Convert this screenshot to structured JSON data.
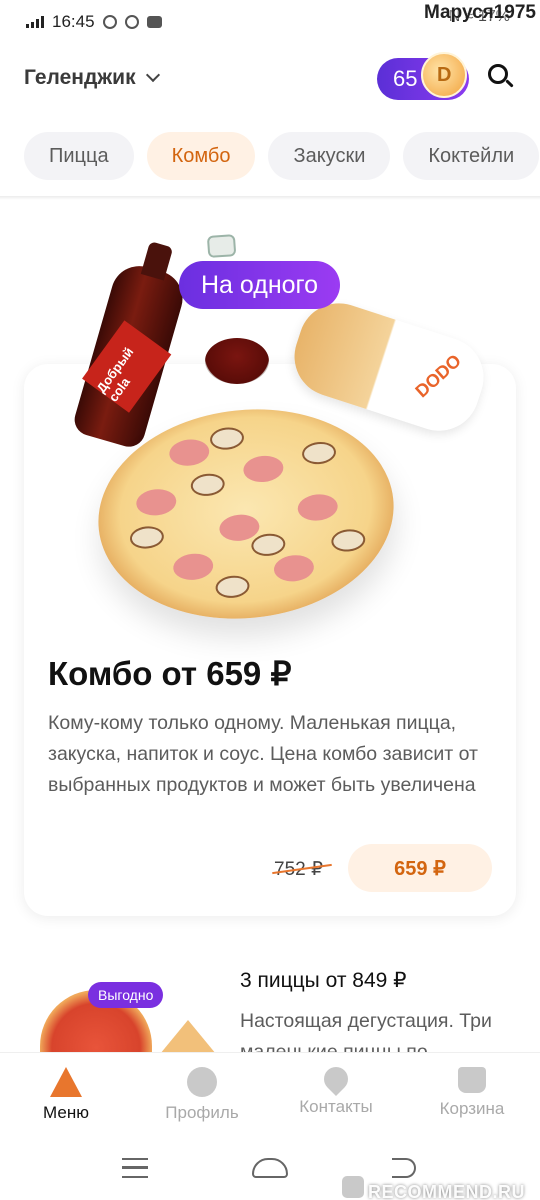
{
  "status_bar": {
    "time": "16:45",
    "right_icons": "N ≈ 17%",
    "watermark_user": "Маруся1975"
  },
  "header": {
    "city": "Геленджик",
    "coins": "65"
  },
  "tabs": [
    {
      "label": "Пицца"
    },
    {
      "label": "Комбо",
      "active": true
    },
    {
      "label": "Закуски"
    },
    {
      "label": "Коктейли"
    }
  ],
  "combo": {
    "badge": "На одного",
    "bottle_label": "Добрый cola",
    "roll_brand": "DODO",
    "title": "Комбо от 659 ₽",
    "description": "Кому-кому только одному. Маленькая пицца, закуска, напиток и соус. Цена комбо зависит от выбранных продуктов и может быть увеличена",
    "old_price": "752 ₽",
    "price": "659 ₽"
  },
  "product2": {
    "badge": "Выгодно",
    "title": "3 пиццы от 849 ₽",
    "description": "Настоящая дегустация. Три маленькие пиццы по"
  },
  "bottom_nav": {
    "menu": "Меню",
    "profile": "Профиль",
    "contacts": "Контакты",
    "cart": "Корзина"
  },
  "watermark": "RECOMMEND.RU"
}
